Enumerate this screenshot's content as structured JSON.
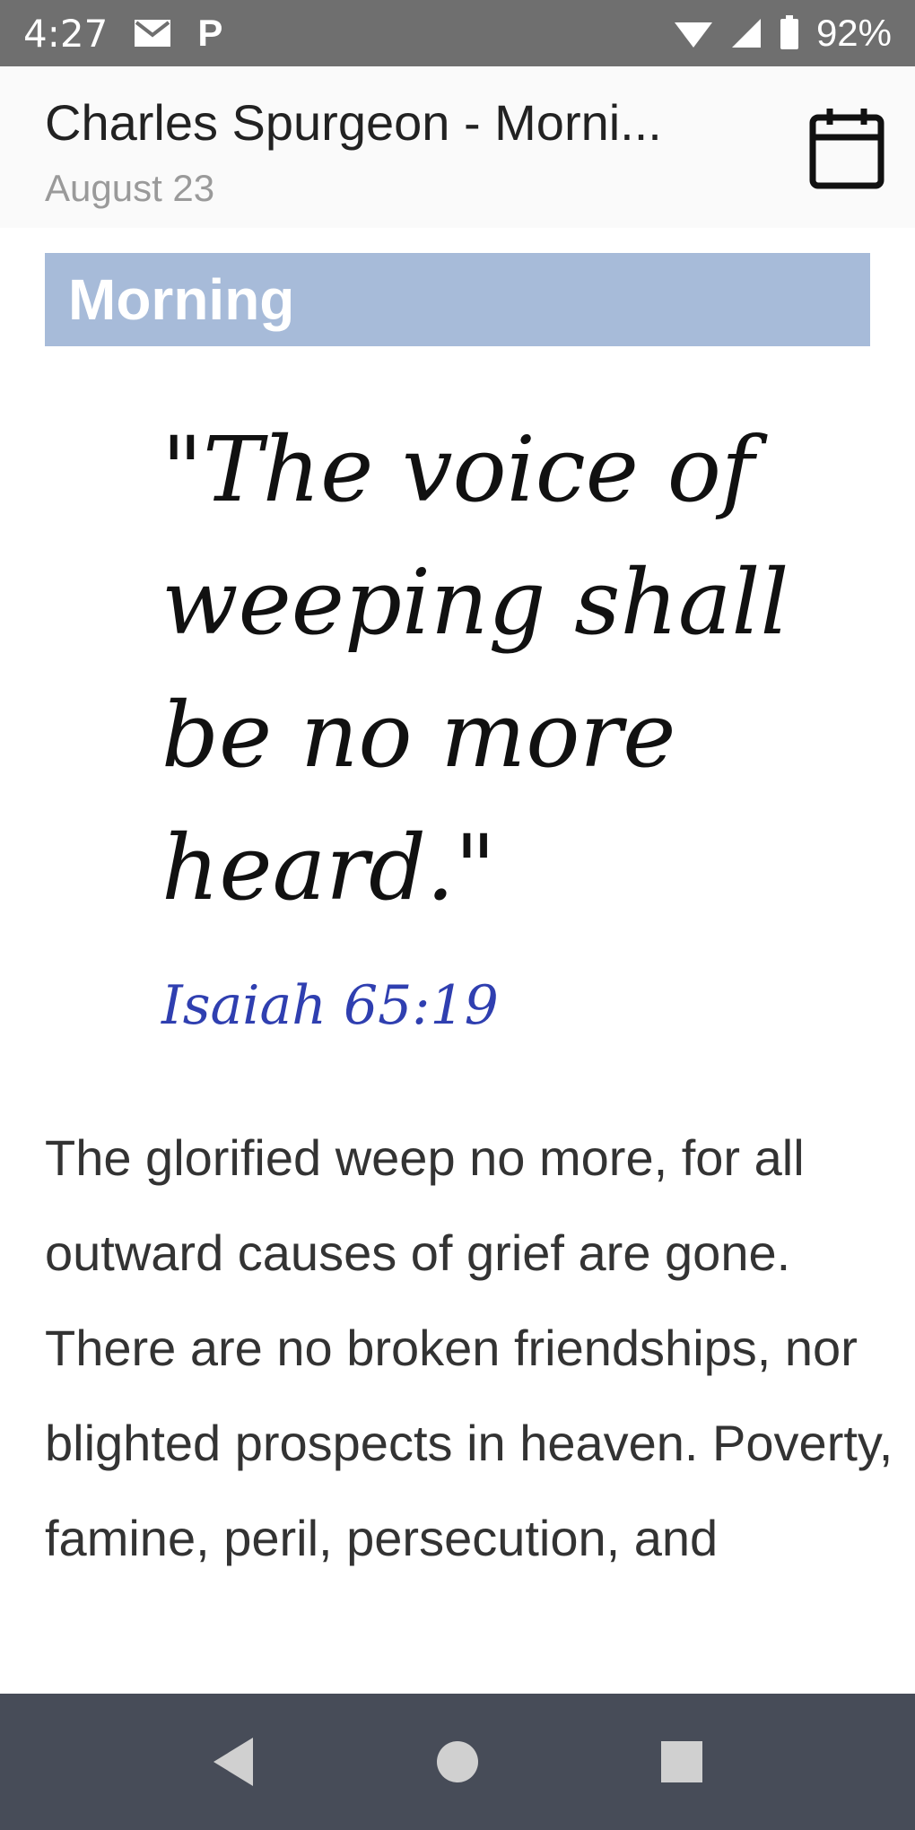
{
  "status": {
    "time": "4:27",
    "left_icons": [
      "mail-icon",
      "p-icon"
    ],
    "p_glyph": "P",
    "right_icons": [
      "wifi-icon",
      "signal-icon",
      "battery-icon"
    ],
    "battery": "92%"
  },
  "header": {
    "title": "Charles Spurgeon - Morni...",
    "subtitle": "August 23",
    "action_icon": "calendar-icon"
  },
  "content": {
    "section": "Morning",
    "verse": "\"The voice of weeping shall be no more heard.\"",
    "reference": "Isaiah 65:19",
    "body": "The glorified weep no more, for all outward causes of grief are gone. There are no broken friendships, nor blighted prospects in heaven. Poverty, famine, peril, persecution, and"
  },
  "nav": {
    "back_icon": "back-triangle-icon",
    "home_icon": "home-circle-icon",
    "recents_icon": "recents-square-icon"
  },
  "colors": {
    "status_bar": "#6f6f6f",
    "banner": "#a7bbd9",
    "reference": "#2f3fb0",
    "nav_bar": "#474c58"
  }
}
